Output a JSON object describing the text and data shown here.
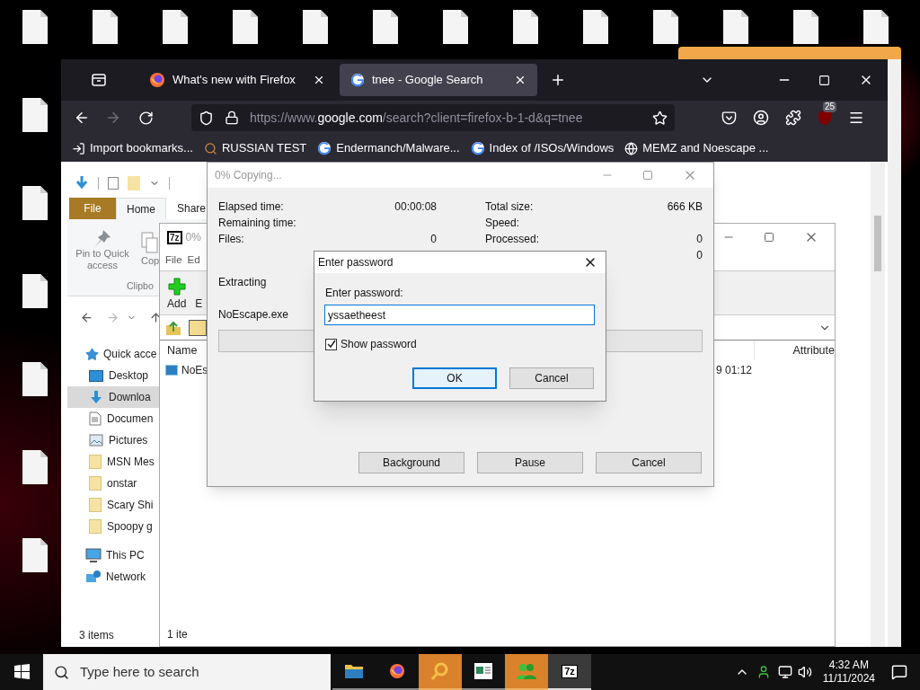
{
  "desktop": {
    "top_row": [
      {
        "kind": "file"
      },
      {
        "kind": "file"
      },
      {
        "kind": "file"
      },
      {
        "kind": "file"
      },
      {
        "kind": "file"
      },
      {
        "kind": "file"
      },
      {
        "kind": "file"
      },
      {
        "kind": "file"
      },
      {
        "kind": "file"
      },
      {
        "kind": "file"
      },
      {
        "kind": "file"
      },
      {
        "kind": "file"
      },
      {
        "kind": "file"
      }
    ],
    "left_column": [
      {
        "kind": "file"
      },
      {
        "kind": "file"
      },
      {
        "kind": "file"
      },
      {
        "kind": "file"
      },
      {
        "kind": "file"
      },
      {
        "kind": "file"
      }
    ]
  },
  "firefox": {
    "tabs": [
      {
        "label": "What's new with Firefox",
        "kind": "firefox",
        "selected": false
      },
      {
        "label": "tnee - Google Search",
        "kind": "google",
        "selected": true
      }
    ],
    "url": {
      "scheme": "https://www.",
      "domain": "google.com",
      "path": "/search?client=firefox-b-1-d&q=tnee"
    },
    "badge": "25",
    "bookmarks": [
      {
        "label": "Import bookmarks...",
        "kind": "import"
      },
      {
        "label": "RUSSIAN TEST",
        "kind": "search"
      },
      {
        "label": "Endermanch/Malware...",
        "kind": "google"
      },
      {
        "label": "Index of /ISOs/Windows",
        "kind": "google"
      },
      {
        "label": "MEMZ and Noescape ...",
        "kind": "globe"
      }
    ]
  },
  "explorer": {
    "tabs": [
      {
        "label": "File",
        "kind": "file"
      },
      {
        "label": "Home",
        "kind": "tab"
      },
      {
        "label": "Share",
        "kind": "tab"
      }
    ],
    "ribbon": {
      "pin": "Pin to Quick access",
      "copy": "Cop",
      "group": "Clipbo"
    },
    "tree": [
      {
        "label": "Quick acce",
        "kind": "star",
        "selected": false,
        "children": [
          {
            "label": "Desktop",
            "kind": "desktop",
            "selected": false
          },
          {
            "label": "Downloa",
            "kind": "download",
            "selected": true
          },
          {
            "label": "Documen",
            "kind": "document",
            "selected": false
          },
          {
            "label": "Pictures",
            "kind": "pictures",
            "selected": false
          },
          {
            "label": "MSN Mes",
            "kind": "folder",
            "selected": false
          },
          {
            "label": "onstar",
            "kind": "folder",
            "selected": false
          },
          {
            "label": "Scary Shi",
            "kind": "folder",
            "selected": false
          },
          {
            "label": "Spoopy g",
            "kind": "folder",
            "selected": false
          }
        ]
      },
      {
        "label": "This PC",
        "kind": "pc",
        "selected": false
      },
      {
        "label": "Network",
        "kind": "network",
        "selected": false
      }
    ],
    "status": "3 items"
  },
  "sevenzip": {
    "logo": "7z",
    "title": "0%",
    "menu": [
      "File",
      "Ed"
    ],
    "toolbar": [
      "Add",
      "E"
    ],
    "columns": [
      "Name",
      "Attribute"
    ],
    "row": {
      "name": "NoEs",
      "date": "9 01:12"
    },
    "status": "1 ite"
  },
  "copying": {
    "title": "0% Copying...",
    "left": [
      {
        "label": "Elapsed time:",
        "value": "00:00:08"
      },
      {
        "label": "Remaining time:"
      },
      {
        "label": "Files:",
        "value": "0"
      }
    ],
    "right": [
      {
        "label": "Total size:",
        "value": "666 KB"
      },
      {
        "label": "Speed:"
      },
      {
        "label": "Processed:",
        "value": "0"
      },
      {
        "value": "0"
      }
    ],
    "operation": "Extracting",
    "file": "NoEscape.exe",
    "progress": {
      "level": 0
    },
    "buttons": [
      "Background",
      "Pause",
      "Cancel"
    ]
  },
  "password_dialog": {
    "title": "Enter password",
    "label": "Enter password:",
    "value": "yssaetheest",
    "show_password": {
      "label": "Show password",
      "checked": true
    },
    "ok": "OK",
    "cancel": "Cancel"
  },
  "taskbar": {
    "search_placeholder": "Type here to search",
    "apps": [
      {
        "kind": "folder",
        "flashing": false,
        "active": false
      },
      {
        "kind": "firefox",
        "flashing": false,
        "active": false
      },
      {
        "kind": "magnifier",
        "flashing": true,
        "active": false
      },
      {
        "kind": "window",
        "flashing": false,
        "active": false
      },
      {
        "kind": "people",
        "flashing": true,
        "active": false
      },
      {
        "kind": "sevenzip",
        "label": "7z",
        "flashing": false,
        "active": true
      }
    ],
    "time": "4:32 AM",
    "date": "11/11/2024"
  }
}
